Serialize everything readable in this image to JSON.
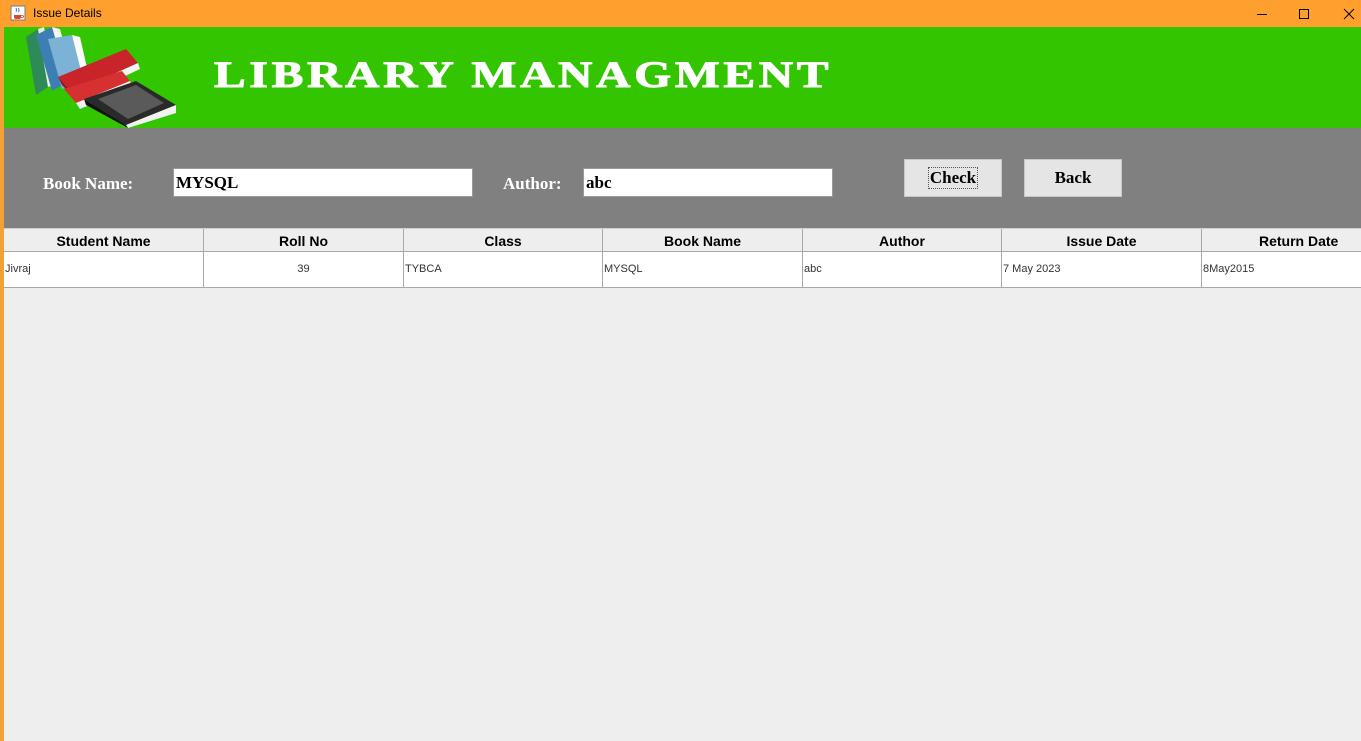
{
  "window": {
    "title": "Issue Details",
    "icon": "java-cup-icon",
    "controls": [
      "minimize",
      "maximize",
      "close"
    ]
  },
  "header": {
    "title": "LIBRARY  MANAGMENT",
    "logo": "stacked-books-logo",
    "background": "#33c600"
  },
  "form": {
    "book_label": "Book Name:",
    "book_value": "MYSQL",
    "author_label": "Author:",
    "author_value": "abc",
    "check_label": "Check",
    "back_label": "Back",
    "background": "#808080"
  },
  "table": {
    "columns": [
      "Student Name",
      "Roll No",
      "Class",
      "Book Name",
      "Author",
      "Issue Date",
      "Return Date"
    ],
    "rows": [
      {
        "student_name": "Jivraj",
        "roll_no": "39",
        "class": "TYBCA",
        "book_name": "MYSQL",
        "author": "abc",
        "issue_date": "7 May 2023",
        "return_date": "8May2015"
      }
    ]
  },
  "colors": {
    "titlebar": "#ffa02e",
    "header_green": "#33c600",
    "form_gray": "#808080"
  }
}
